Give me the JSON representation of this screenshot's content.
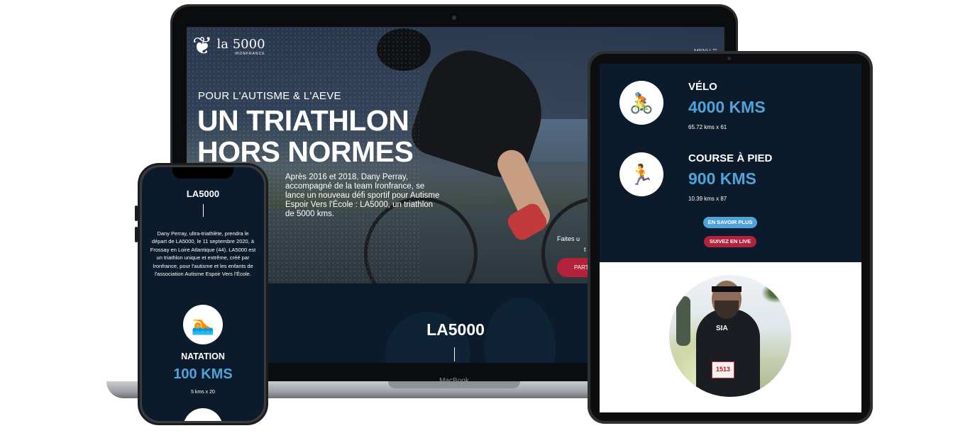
{
  "laptop": {
    "brand": "MacBook",
    "hero": {
      "logo_mark": "❦",
      "logo_name": "la 5000",
      "logo_sub": "IRONFRANCE",
      "menu": "MENU ☰",
      "kicker": "POUR L'AUTISME & L'AEVE",
      "title": "UN TRIATHLON HORS NORMES",
      "text": "Après 2016 et 2018, Dany Perray, accompagné de la team Ironfrance, se lance un nouveau défi sportif pour Autisme Espoir Vers l'École : LA5000, un triathlon de 5000 kms.",
      "side_text_1": "Faites u",
      "side_text_2": "t",
      "button": "PART"
    },
    "section2": {
      "title": "LA5000"
    }
  },
  "tablet": {
    "stats": [
      {
        "icon": "🚴",
        "label": "VÉLO",
        "value": "4000 KMS",
        "note": "65.72 kms x 61"
      },
      {
        "icon": "🏃",
        "label": "COURSE À PIED",
        "value": "900 KMS",
        "note": "10.39 kms x 87"
      }
    ],
    "buttons": {
      "more": "EN SAVOIR PLUS",
      "live": "SUIVEZ EN LIVE"
    },
    "photo": {
      "jersey": "SIA",
      "bib": "1513"
    },
    "colors": {
      "more_btn": "#4fa3d8",
      "live_btn": "#b3213a"
    }
  },
  "phone": {
    "title": "LA5000",
    "text": "Dany Perray, ultra-triathlète, prendra le départ de LA5000, le 11 septembre 2020, à Frossay en Loire Atlantique (44). LA5000 est un triathlon unique et extrême, créé par Ironfrance, pour l'autisme et les enfants de l'association Autisme Espoir Vers l'École.",
    "stat": {
      "icon": "🏊",
      "label": "NATATION",
      "value": "100 KMS",
      "note": "5 kms x 20"
    }
  },
  "colors": {
    "navy": "#0b1b2c",
    "accent_blue": "#4fa3d8",
    "accent_red": "#b3213a"
  }
}
